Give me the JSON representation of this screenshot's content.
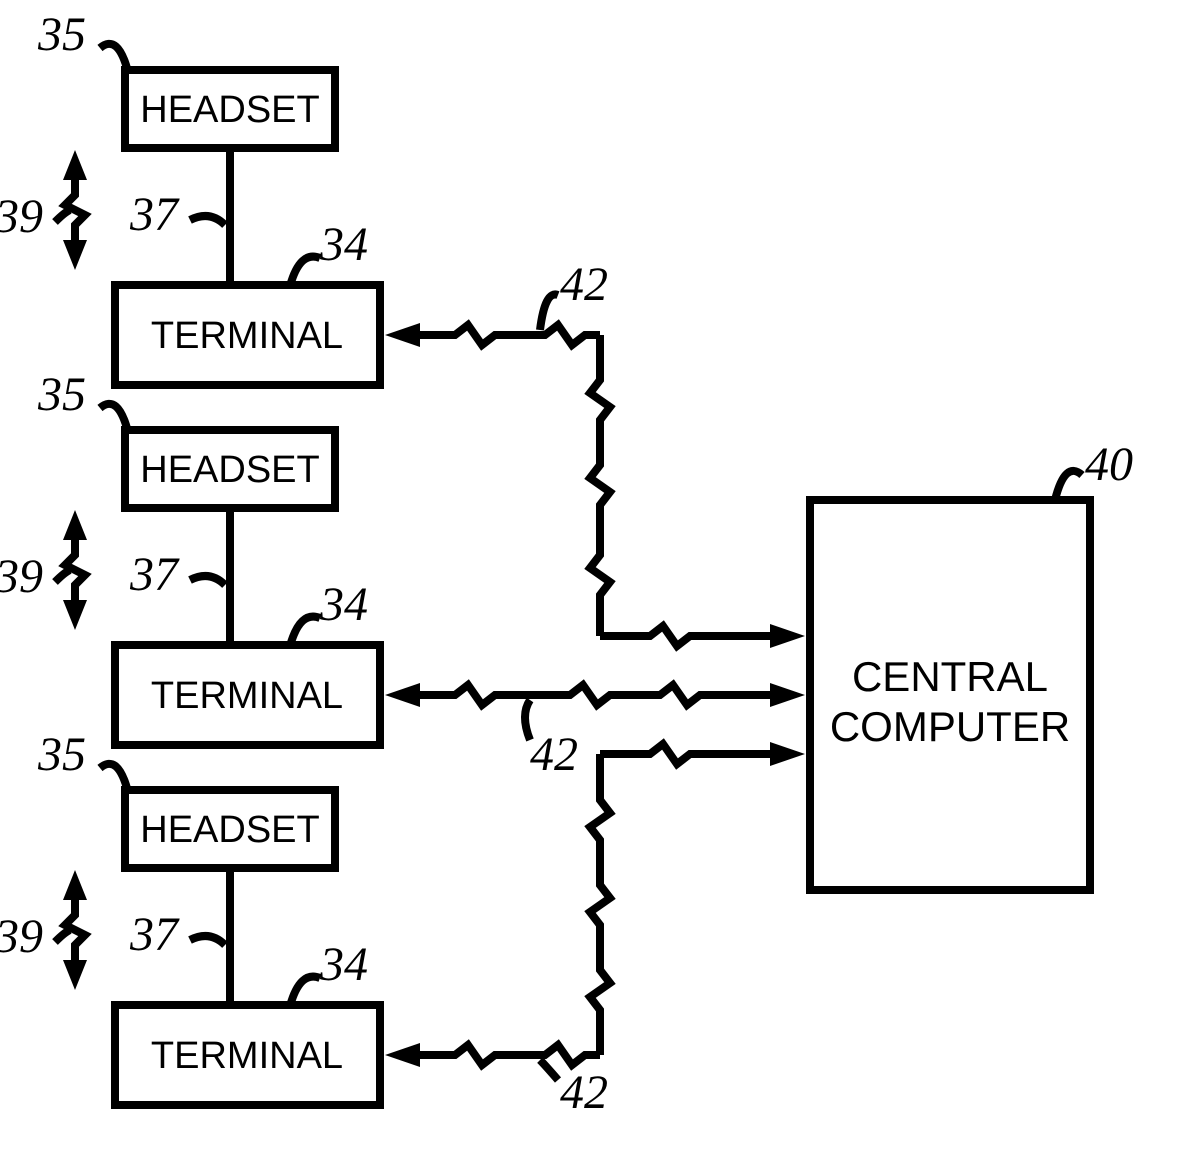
{
  "refs": {
    "headset": "35",
    "terminal": "34",
    "link_ht": "37",
    "link_ht_arrow": "39",
    "central": "40",
    "link_tc": "42"
  },
  "labels": {
    "headset": "HEADSET",
    "terminal": "TERMINAL",
    "central_line1": "CENTRAL",
    "central_line2": "COMPUTER"
  }
}
